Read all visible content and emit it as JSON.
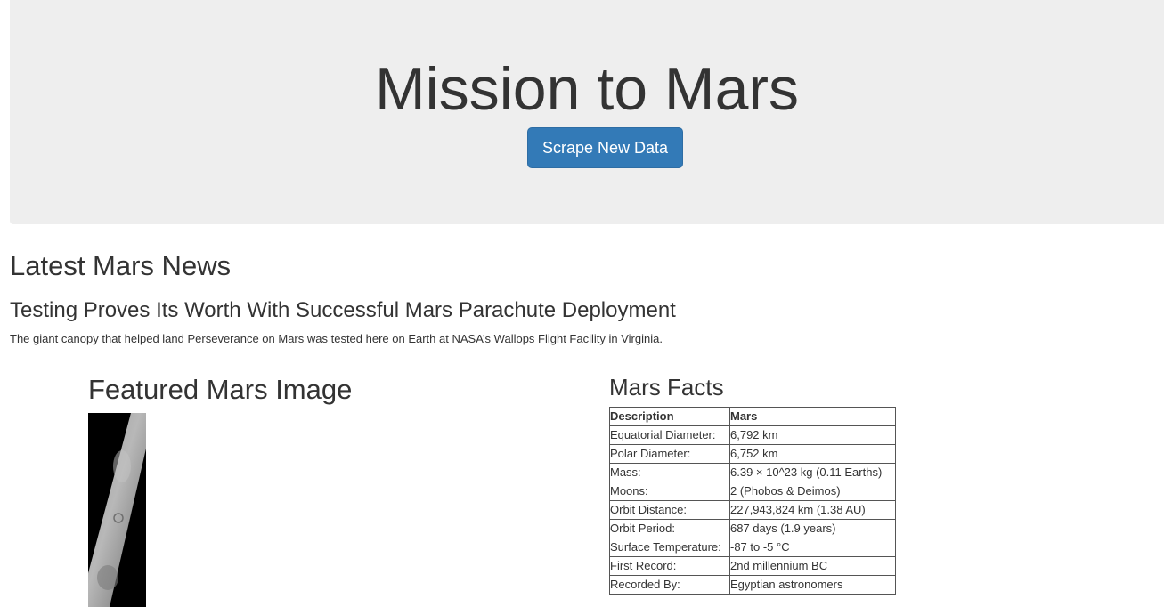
{
  "jumbotron": {
    "title": "Mission to Mars",
    "button_label": "Scrape New Data",
    "background": "#eeeeee",
    "button_color": "#337ab7"
  },
  "news": {
    "heading": "Latest Mars News",
    "title": "Testing Proves Its Worth With Successful Mars Parachute Deployment",
    "teaser": "The giant canopy that helped land Perseverance on Mars was tested here on Earth at NASA’s Wallops Flight Facility in Virginia."
  },
  "featured": {
    "heading": "Featured Mars Image"
  },
  "facts": {
    "heading": "Mars Facts",
    "columns": [
      "Description",
      "Mars"
    ],
    "rows": [
      [
        "Equatorial Diameter:",
        "6,792 km"
      ],
      [
        "Polar Diameter:",
        "6,752 km"
      ],
      [
        "Mass:",
        "6.39 × 10^23 kg (0.11 Earths)"
      ],
      [
        "Moons:",
        "2 (Phobos & Deimos)"
      ],
      [
        "Orbit Distance:",
        "227,943,824 km (1.38 AU)"
      ],
      [
        "Orbit Period:",
        "687 days (1.9 years)"
      ],
      [
        "Surface Temperature:",
        "-87 to -5 °C"
      ],
      [
        "First Record:",
        "2nd millennium BC"
      ],
      [
        "Recorded By:",
        "Egyptian astronomers"
      ]
    ]
  }
}
